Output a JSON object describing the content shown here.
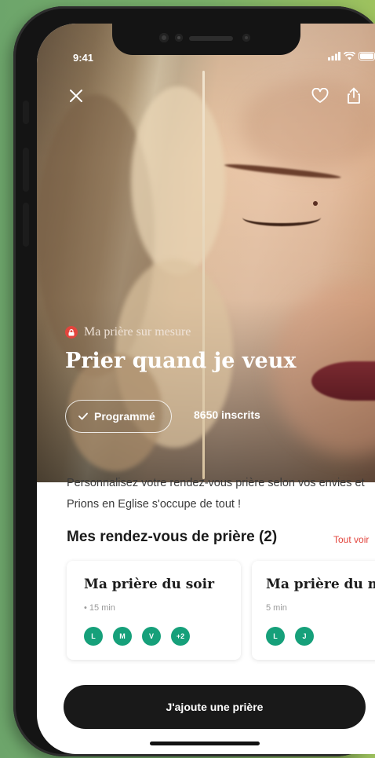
{
  "status_bar": {
    "time": "9:41",
    "signal_icon": "signal-icon",
    "wifi_icon": "wifi-icon",
    "battery_icon": "battery-icon"
  },
  "top_actions": {
    "close_icon": "close-icon",
    "favorite_icon": "heart-icon",
    "share_icon": "share-icon"
  },
  "hero": {
    "tag_label": "Ma prière sur mesure",
    "title": "Prier quand je veux",
    "program_button": "Programmé",
    "subscribers": "8650 inscrits"
  },
  "description": "Personnalisez votre rendez-vous prière selon vos envies et Prions en Eglise s'occupe de tout !",
  "appointments": {
    "section_title": "Mes rendez-vous de prière (2)",
    "see_all": "Tout voir",
    "cards": [
      {
        "title": "Ma prière du soir",
        "duration": "• 15 min",
        "days": [
          "L",
          "M",
          "V",
          "+2"
        ]
      },
      {
        "title": "Ma prière du m",
        "duration": "5 min",
        "days": [
          "L",
          "J"
        ]
      }
    ]
  },
  "cta_button": "J'ajoute une prière",
  "colors": {
    "accent_red": "#e2453d",
    "day_green": "#16a07a",
    "cta_dark": "#191919",
    "background_green": "#7ab06a"
  }
}
